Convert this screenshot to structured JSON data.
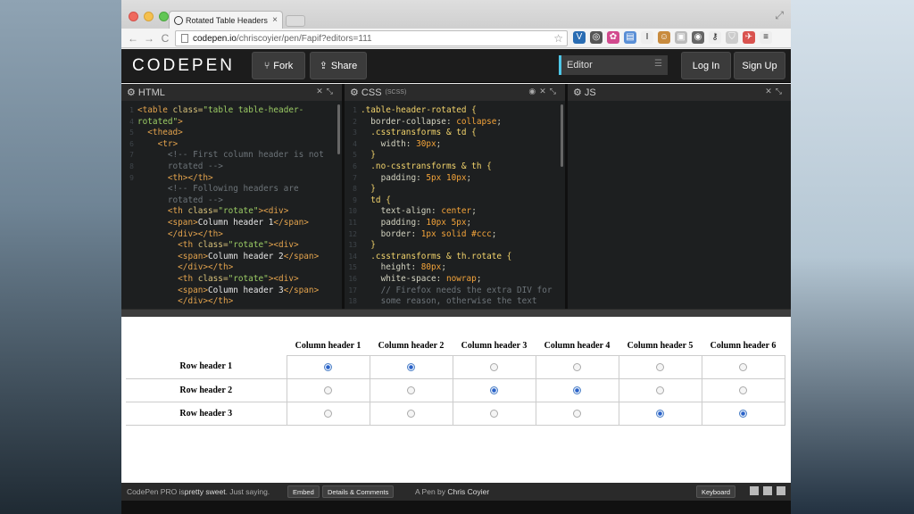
{
  "browser": {
    "tab_title": "Rotated Table Headers - C",
    "tab_close": "×",
    "url_host": "codepen.io",
    "url_path": "/chriscoyier/pen/Fapif?editors=111",
    "nav": {
      "back": "←",
      "forward": "→",
      "reload": "C"
    }
  },
  "codepen": {
    "logo": "CODEPEN",
    "fork_label": "Fork",
    "share_label": "Share",
    "editor_select": "Editor",
    "login_label": "Log In",
    "signup_label": "Sign Up"
  },
  "panes": {
    "html": {
      "title": "HTML",
      "gutter": [
        "1",
        "",
        "",
        "",
        "4",
        "",
        "5",
        "6",
        "",
        "7",
        "",
        "8",
        "",
        "",
        "9",
        ""
      ],
      "lines": [
        [
          [
            "c-tag",
            "<table "
          ],
          [
            "c-attr",
            "class="
          ],
          [
            "c-str",
            "\"table table-header-"
          ]
        ],
        [
          [
            "c-str",
            "rotated\""
          ],
          [
            "c-tag",
            ">"
          ]
        ],
        [
          [
            "c-tag",
            "  <thead>"
          ]
        ],
        [
          [
            "c-tag",
            "    <tr>"
          ]
        ],
        [
          [
            "c-com",
            "      <!-- First column header is not"
          ]
        ],
        [
          [
            "c-com",
            "      rotated -->"
          ]
        ],
        [
          [
            "c-tag",
            "      <th></th>"
          ]
        ],
        [
          [
            "c-com",
            "      <!-- Following headers are"
          ]
        ],
        [
          [
            "c-com",
            "      rotated -->"
          ]
        ],
        [
          [
            "c-tag",
            "      <th "
          ],
          [
            "c-attr",
            "class="
          ],
          [
            "c-str",
            "\"rotate\""
          ],
          [
            "c-tag",
            "><div>"
          ]
        ],
        [
          [
            "c-tag",
            "      <span>"
          ],
          [
            "c-txt",
            "Column header 1"
          ],
          [
            "c-tag",
            "</span>"
          ]
        ],
        [
          [
            "c-tag",
            "      </div></th>"
          ]
        ],
        [
          [
            "c-tag",
            "        <th "
          ],
          [
            "c-attr",
            "class="
          ],
          [
            "c-str",
            "\"rotate\""
          ],
          [
            "c-tag",
            "><div>"
          ]
        ],
        [
          [
            "c-tag",
            "        <span>"
          ],
          [
            "c-txt",
            "Column header 2"
          ],
          [
            "c-tag",
            "</span>"
          ]
        ],
        [
          [
            "c-tag",
            "        </div></th>"
          ]
        ],
        [
          [
            "c-tag",
            "        <th "
          ],
          [
            "c-attr",
            "class="
          ],
          [
            "c-str",
            "\"rotate\""
          ],
          [
            "c-tag",
            "><div>"
          ]
        ],
        [
          [
            "c-tag",
            "        <span>"
          ],
          [
            "c-txt",
            "Column header 3"
          ],
          [
            "c-tag",
            "</span>"
          ]
        ],
        [
          [
            "c-tag",
            "        </div></th>"
          ]
        ]
      ]
    },
    "css": {
      "title": "CSS",
      "subtitle": "(SCSS)",
      "gutter": [
        "1",
        "2",
        "3",
        "4",
        "5",
        "6",
        "7",
        "8",
        "9",
        "10",
        "11",
        "12",
        "13",
        "14",
        "15",
        "16",
        "17",
        "18"
      ],
      "lines": [
        [
          [
            "c-sel",
            ".table-header-rotated {"
          ]
        ],
        [
          [
            "c-prop",
            "  border-collapse: "
          ],
          [
            "c-val",
            "collapse"
          ],
          [
            "c-prop",
            ";"
          ]
        ],
        [
          [
            "c-sel",
            "  .csstransforms & td {"
          ]
        ],
        [
          [
            "c-prop",
            "    width: "
          ],
          [
            "c-val",
            "30px"
          ],
          [
            "c-prop",
            ";"
          ]
        ],
        [
          [
            "c-sel",
            "  }"
          ]
        ],
        [
          [
            "c-sel",
            "  .no-csstransforms & th {"
          ]
        ],
        [
          [
            "c-prop",
            "    padding: "
          ],
          [
            "c-val",
            "5px 10px"
          ],
          [
            "c-prop",
            ";"
          ]
        ],
        [
          [
            "c-sel",
            "  }"
          ]
        ],
        [
          [
            "c-sel",
            "  td {"
          ]
        ],
        [
          [
            "c-prop",
            "    text-align: "
          ],
          [
            "c-val",
            "center"
          ],
          [
            "c-prop",
            ";"
          ]
        ],
        [
          [
            "c-prop",
            "    padding: "
          ],
          [
            "c-val",
            "10px 5px"
          ],
          [
            "c-prop",
            ";"
          ]
        ],
        [
          [
            "c-prop",
            "    border: "
          ],
          [
            "c-val",
            "1px solid #ccc"
          ],
          [
            "c-prop",
            ";"
          ]
        ],
        [
          [
            "c-sel",
            "  }"
          ]
        ],
        [
          [
            "c-sel",
            "  .csstransforms & th.rotate {"
          ]
        ],
        [
          [
            "c-prop",
            "    height: "
          ],
          [
            "c-val",
            "80px"
          ],
          [
            "c-prop",
            ";"
          ]
        ],
        [
          [
            "c-prop",
            "    white-space: "
          ],
          [
            "c-val",
            "nowrap"
          ],
          [
            "c-prop",
            ";"
          ]
        ],
        [
          [
            "c-com",
            "    // Firefox needs the extra DIV for"
          ]
        ],
        [
          [
            "c-com",
            "    some reason, otherwise the text"
          ]
        ]
      ]
    },
    "js": {
      "title": "JS"
    }
  },
  "preview_table": {
    "columns": [
      "Column header 1",
      "Column header 2",
      "Column header 3",
      "Column header 4",
      "Column header 5",
      "Column header 6"
    ],
    "rows": [
      {
        "header": "Row header 1",
        "checked": [
          true,
          true,
          false,
          false,
          false,
          false
        ]
      },
      {
        "header": "Row header 2",
        "checked": [
          false,
          false,
          true,
          true,
          false,
          false
        ]
      },
      {
        "header": "Row header 3",
        "checked": [
          false,
          false,
          false,
          false,
          true,
          true
        ]
      }
    ]
  },
  "footer": {
    "promo_prefix": "CodePen PRO is ",
    "promo_emph": "pretty sweet",
    "promo_suffix": ". Just saying.",
    "embed_label": "Embed",
    "details_label": "Details & Comments",
    "pen_by": "A Pen by ",
    "author": "Chris Coyier",
    "keyboard_label": "Keyboard"
  }
}
